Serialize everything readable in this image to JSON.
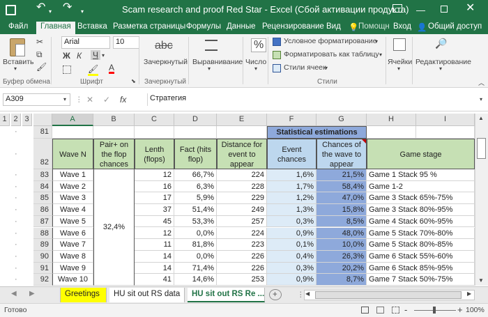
{
  "window": {
    "title": "Scam research and proof Red Star - Excel (Сбой активации продукта)"
  },
  "menu": {
    "tabs": [
      "Файл",
      "Главная",
      "Вставка",
      "Разметка страницы",
      "Формулы",
      "Данные",
      "Рецензирование",
      "Вид"
    ],
    "help": "Помощн",
    "signin": "Вход",
    "share": "Общий доступ"
  },
  "ribbon": {
    "paste": "Вставить",
    "clipboard": "Буфер обмена",
    "font_name": "Arial",
    "font_size": "10",
    "bold": "Ж",
    "italic": "К",
    "underline": "Ч",
    "font_color_letter": "А",
    "font_group": "Шрифт",
    "strike_sample": "abc",
    "strike_label": "Зачеркнутый",
    "strike_group": "Зачеркнутый",
    "align": "Выравнивание",
    "number": "Число",
    "number_icon": "%",
    "cond_format": "Условное форматирование",
    "format_table": "Форматировать как таблицу",
    "cell_styles": "Стили ячеек",
    "styles_group": "Стили",
    "cells": "Ячейки",
    "editing": "Редактирование"
  },
  "formula_bar": {
    "name_box": "A309",
    "fx": "fx",
    "value": "Стратегия"
  },
  "grid": {
    "outline_levels": [
      "1",
      "2",
      "3"
    ],
    "columns": [
      "A",
      "B",
      "C",
      "D",
      "E",
      "F",
      "G",
      "H",
      "I"
    ],
    "row81": {
      "num": "81",
      "stat_header": "Statistical estimations"
    },
    "row82": {
      "num": "82",
      "A": "Wave N",
      "B": "Pair+ on the flop chances",
      "C": "Lenth (flops)",
      "D": "Fact (hits flop)",
      "E": "Distance for event to appear",
      "F": "Event chances",
      "G": "Chances of the wave to appear",
      "H": "Game stage"
    },
    "merged_B": "32,4%",
    "rows": [
      {
        "num": "83",
        "A": "Wave 1",
        "C": "12",
        "D": "66,7%",
        "E": "224",
        "F": "1,6%",
        "G": "21,5%",
        "H": "Game 1 Stack 95 %"
      },
      {
        "num": "84",
        "A": "Wave 2",
        "C": "16",
        "D": "6,3%",
        "E": "228",
        "F": "1,7%",
        "G": "58,4%",
        "H": "Game 1-2"
      },
      {
        "num": "85",
        "A": "Wave 3",
        "C": "17",
        "D": "5,9%",
        "E": "229",
        "F": "1,2%",
        "G": "47,0%",
        "H": "Game 3 Stack 65%-75%"
      },
      {
        "num": "86",
        "A": "Wave 4",
        "C": "37",
        "D": "51,4%",
        "E": "249",
        "F": "1,3%",
        "G": "15,8%",
        "H": "Game 3 Stack 80%-95%"
      },
      {
        "num": "87",
        "A": "Wave 5",
        "C": "45",
        "D": "53,3%",
        "E": "257",
        "F": "0,3%",
        "G": "8,5%",
        "H": "Game 4 Stack 60%-95%"
      },
      {
        "num": "88",
        "A": "Wave 6",
        "C": "12",
        "D": "0,0%",
        "E": "224",
        "F": "0,9%",
        "G": "48,0%",
        "H": "Game 5 Stack 70%-80%"
      },
      {
        "num": "89",
        "A": "Wave 7",
        "C": "11",
        "D": "81,8%",
        "E": "223",
        "F": "0,1%",
        "G": "10,0%",
        "H": "Game 5 Stack 80%-85%"
      },
      {
        "num": "90",
        "A": "Wave 8",
        "C": "14",
        "D": "0,0%",
        "E": "226",
        "F": "0,4%",
        "G": "26,3%",
        "H": "Game 6 Stack 55%-60%"
      },
      {
        "num": "91",
        "A": "Wave 9",
        "C": "14",
        "D": "71,4%",
        "E": "226",
        "F": "0,3%",
        "G": "20,2%",
        "H": "Game 6 Stack 85%-95%"
      },
      {
        "num": "92",
        "A": "Wave 10",
        "C": "41",
        "D": "14,6%",
        "E": "253",
        "F": "0,9%",
        "G": "8,7%",
        "H": "Game 7 Stack 50%-75%"
      }
    ]
  },
  "sheets": {
    "tabs": [
      "Greetings",
      "HU sit out RS data",
      "HU sit out RS Re ..."
    ],
    "tab_colors": [
      "#ffff00",
      "#ffffff",
      "#ffffff"
    ],
    "add": "+"
  },
  "status": {
    "ready": "Готово",
    "zoom": "100%",
    "zoom_minus": "-",
    "zoom_plus": "+"
  },
  "colors": {
    "excel_green": "#217346",
    "header_green": "#c6e0b4",
    "header_blue": "#bdd7ee",
    "col_g_blue": "#8ea9db",
    "col_f_blue": "#ddebf7"
  }
}
